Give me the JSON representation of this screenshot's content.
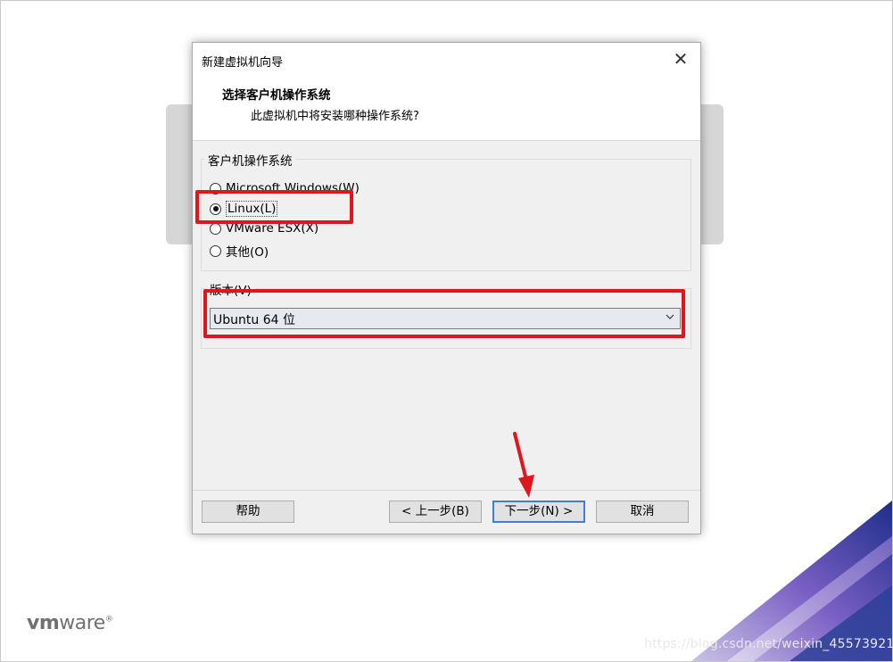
{
  "dialog": {
    "title": "新建虚拟机向导",
    "header_title": "选择客户机操作系统",
    "header_subtitle": "此虚拟机中将安装哪种操作系统?"
  },
  "os_group": {
    "label": "客户机操作系统",
    "options": [
      {
        "label": "Microsoft Windows(W)",
        "selected": false
      },
      {
        "label": "Linux(L)",
        "selected": true
      },
      {
        "label": "VMware ESX(X)",
        "selected": false
      },
      {
        "label": "其他(O)",
        "selected": false
      }
    ]
  },
  "version_group": {
    "label": "版本(V)",
    "selected": "Ubuntu 64 位"
  },
  "buttons": {
    "help": "帮助",
    "back": "< 上一步(B)",
    "next": "下一步(N) >",
    "cancel": "取消"
  },
  "branding": {
    "logo_bold": "vm",
    "logo_rest": "ware",
    "logo_mark": "®",
    "watermark": "https://blog.csdn.net/weixin_45573921"
  },
  "colors": {
    "highlight": "#e0161e",
    "dialog_bg": "#f0f0f0",
    "corner_purple": "#5a3fa8",
    "corner_blue": "#1c3f8f"
  }
}
